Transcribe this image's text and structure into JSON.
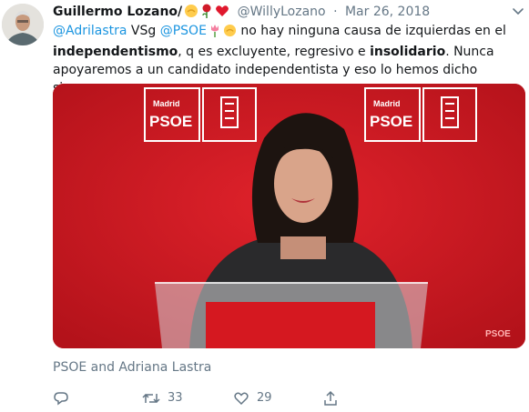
{
  "tweet": {
    "display_name": "Guillermo Lozano/",
    "handle": "@WillyLozano",
    "separator": "·",
    "date": "Mar 26, 2018",
    "body": {
      "mention1": "@Adrilastra",
      "t1": " VSg ",
      "mention2": "@PSOE",
      "t2": " no hay ninguna causa de izquierdas en el ",
      "bold1": "independentismo",
      "t3": ", q es excluyente, regresivo e ",
      "bold2": "insolidario",
      "t4": ". Nunca apoyaremos a un candidato independentista y eso lo hemos dicho siempre."
    },
    "media": {
      "banner_top": "Madrid",
      "banner_logo": "PSOE",
      "watermark": "PSOE"
    },
    "caption": "PSOE and Adriana Lastra",
    "actions": {
      "retweet_count": "33",
      "like_count": "29"
    }
  },
  "colors": {
    "accent": "#1b95e0",
    "muted": "#657786",
    "psoe_red": "#d2161f"
  },
  "icons": [
    "avatar",
    "raised-fist-emoji",
    "rose-emoji",
    "heart-emoji",
    "tulip-emoji",
    "chevron-down-icon",
    "reply-icon",
    "retweet-icon",
    "like-icon",
    "share-icon"
  ]
}
